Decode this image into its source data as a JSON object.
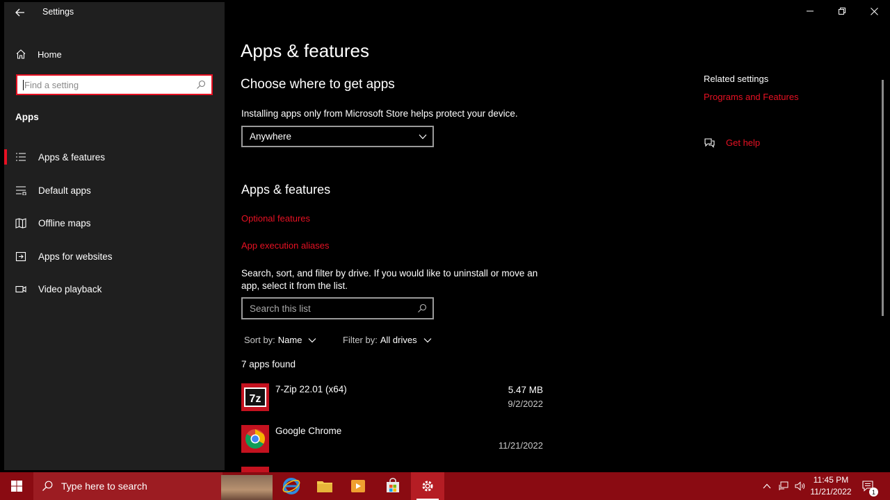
{
  "window": {
    "title": "Settings"
  },
  "sidebar": {
    "home_label": "Home",
    "search_placeholder": "Find a setting",
    "section_title": "Apps",
    "items": [
      {
        "label": "Apps & features",
        "icon": "list-icon",
        "active": true
      },
      {
        "label": "Default apps",
        "icon": "default-apps-icon",
        "active": false
      },
      {
        "label": "Offline maps",
        "icon": "map-icon",
        "active": false
      },
      {
        "label": "Apps for websites",
        "icon": "web-app-icon",
        "active": false
      },
      {
        "label": "Video playback",
        "icon": "video-icon",
        "active": false
      }
    ]
  },
  "main": {
    "page_title": "Apps & features",
    "choose_heading": "Choose where to get apps",
    "choose_desc": "Installing apps only from Microsoft Store helps protect your device.",
    "source_dropdown_value": "Anywhere",
    "apps_heading": "Apps & features",
    "optional_features_link": "Optional features",
    "app_aliases_link": "App execution aliases",
    "search_desc": "Search, sort, and filter by drive. If you would like to uninstall or move an app, select it from the list.",
    "list_search_placeholder": "Search this list",
    "sort_label": "Sort by:",
    "sort_value": "Name",
    "filter_label": "Filter by:",
    "filter_value": "All drives",
    "apps_found": "7 apps found",
    "apps": [
      {
        "name": "7-Zip 22.01 (x64)",
        "size": "5.47 MB",
        "date": "9/2/2022",
        "icon": "7zip-icon"
      },
      {
        "name": "Google Chrome",
        "size": "",
        "date": "11/21/2022",
        "icon": "chrome-icon"
      }
    ]
  },
  "related": {
    "heading": "Related settings",
    "programs_link": "Programs and Features",
    "get_help_link": "Get help"
  },
  "taskbar": {
    "search_placeholder": "Type here to search",
    "time": "11:45 PM",
    "date": "11/21/2022",
    "notification_count": "1"
  },
  "colors": {
    "accent": "#e81123",
    "taskbar": "#8a0b12",
    "sidebar_bg": "#1f1f1f"
  }
}
